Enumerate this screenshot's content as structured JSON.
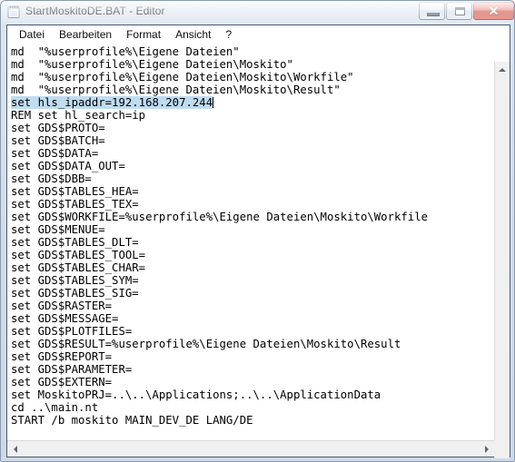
{
  "window": {
    "title": "StartMoskitoDE.BAT - Editor",
    "icon": "notepad-icon",
    "controls": {
      "minimize_label": "Minimieren",
      "maximize_label": "Maximieren",
      "close_label": "✕"
    }
  },
  "menu": {
    "items": [
      {
        "label": "Datei",
        "name": "menu-datei"
      },
      {
        "label": "Bearbeiten",
        "name": "menu-bearbeiten"
      },
      {
        "label": "Format",
        "name": "menu-format"
      },
      {
        "label": "Ansicht",
        "name": "menu-ansicht"
      },
      {
        "label": "?",
        "name": "menu-help"
      }
    ]
  },
  "editor": {
    "selected_line_index": 4,
    "selection_color": "#bfdcf0",
    "lines": [
      "md  \"%userprofile%\\Eigene Dateien\"",
      "md  \"%userprofile%\\Eigene Dateien\\Moskito\"",
      "md  \"%userprofile%\\Eigene Dateien\\Moskito\\Workfile\"",
      "md  \"%userprofile%\\Eigene Dateien\\Moskito\\Result\"",
      "set hls_ipaddr=192.168.207.244",
      "REM set hl_search=ip",
      "set GDS$PROTO=",
      "set GDS$BATCH=",
      "set GDS$DATA=",
      "set GDS$DATA_OUT=",
      "set GDS$DBB=",
      "set GDS$TABLES_HEA=",
      "set GDS$TABLES_TEX=",
      "set GDS$WORKFILE=%userprofile%\\Eigene Dateien\\Moskito\\Workfile",
      "set GDS$MENUE=",
      "set GDS$TABLES_DLT=",
      "set GDS$TABLES_TOOL=",
      "set GDS$TABLES_CHAR=",
      "set GDS$TABLES_SYM=",
      "set GDS$TABLES_SIG=",
      "set GDS$RASTER=",
      "set GDS$MESSAGE=",
      "set GDS$PLOTFILES=",
      "set GDS$RESULT=%userprofile%\\Eigene Dateien\\Moskito\\Result",
      "set GDS$REPORT=",
      "set GDS$PARAMETER=",
      "set GDS$EXTERN=",
      "set MoskitoPRJ=..\\..\\Applications;..\\..\\ApplicationData",
      "cd ..\\main.nt",
      "START /b moskito MAIN_DEV_DE LANG/DE"
    ]
  },
  "scrollbars": {
    "vertical": {
      "up_arrow": "arrow-up-icon",
      "down_arrow": "arrow-down-icon"
    },
    "horizontal": {
      "left_arrow": "arrow-left-icon",
      "right_arrow": "arrow-right-icon"
    }
  }
}
